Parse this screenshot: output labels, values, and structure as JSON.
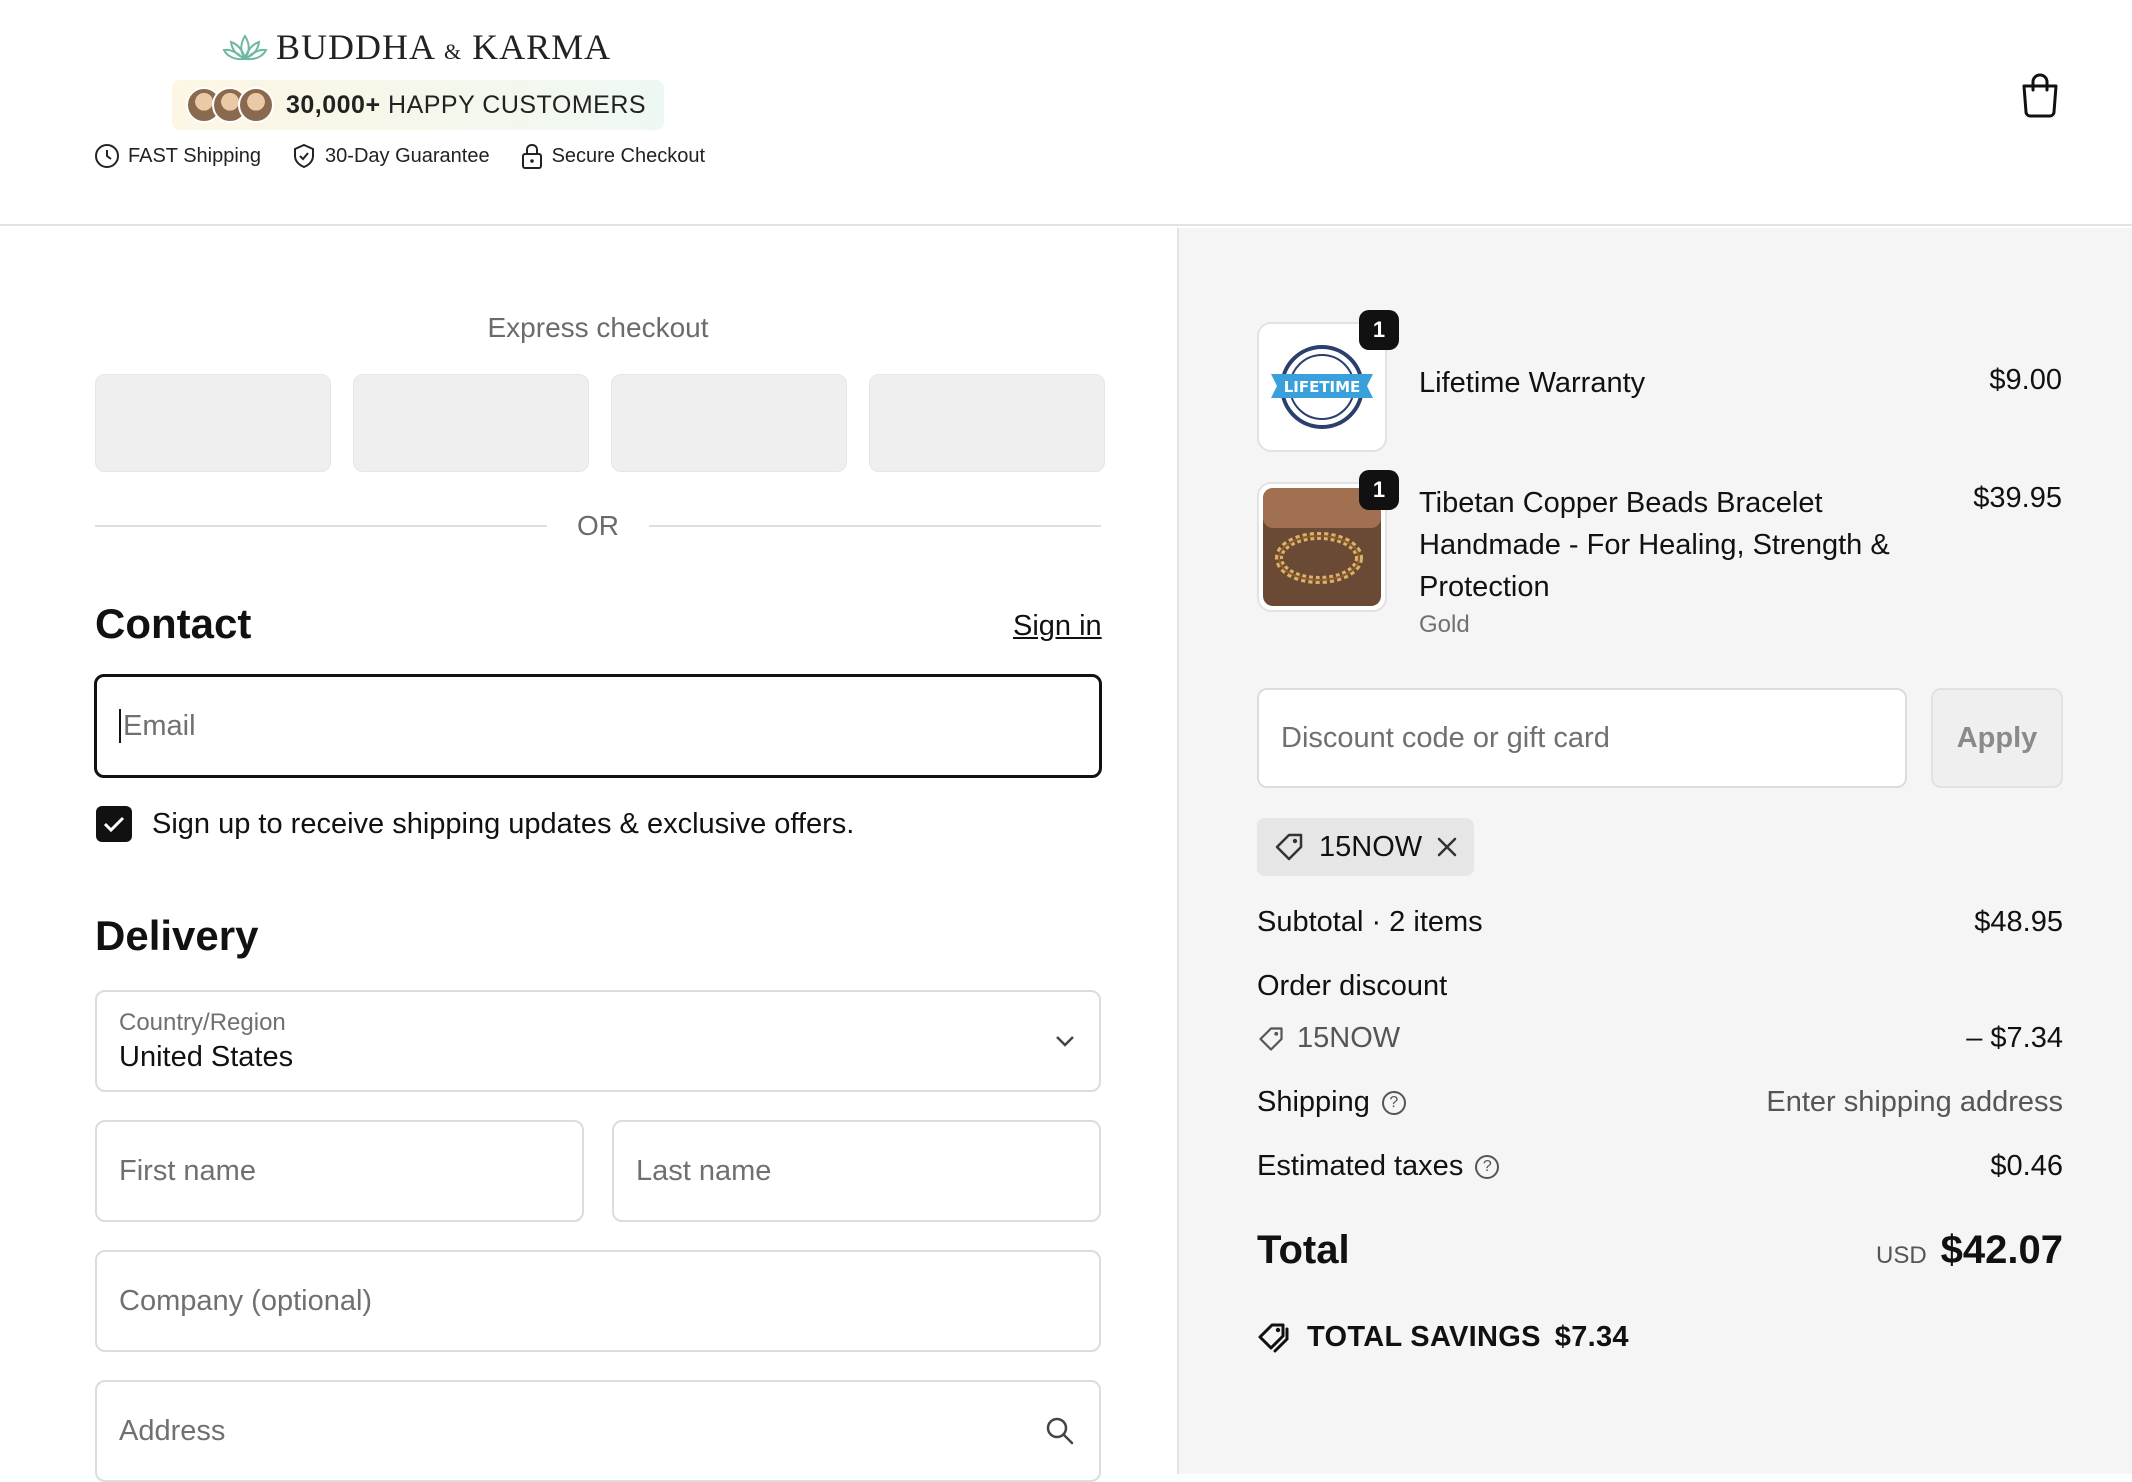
{
  "brand": {
    "name_left": "BUDDHA",
    "name_amp": "&",
    "name_right": "KARMA",
    "happy_count": "30,000+",
    "happy_text": "HAPPY CUSTOMERS"
  },
  "trust_badges": [
    {
      "icon": "clock-icon",
      "label": "FAST Shipping"
    },
    {
      "icon": "shield-check-icon",
      "label": "30-Day Guarantee"
    },
    {
      "icon": "lock-icon",
      "label": "Secure Checkout"
    }
  ],
  "express": {
    "title": "Express checkout",
    "or": "OR"
  },
  "contact": {
    "heading": "Contact",
    "sign_in": "Sign in",
    "email_placeholder": "Email",
    "optin_label": "Sign up to receive shipping updates & exclusive offers.",
    "optin_checked": true
  },
  "delivery": {
    "heading": "Delivery",
    "country_label": "Country/Region",
    "country_value": "United States",
    "first_name_placeholder": "First name",
    "last_name_placeholder": "Last name",
    "company_placeholder": "Company (optional)",
    "address_placeholder": "Address"
  },
  "cart": {
    "items": [
      {
        "name": "Lifetime Warranty",
        "variant": "",
        "qty": "1",
        "price": "$9.00",
        "thumb_text": "LIFETIME"
      },
      {
        "name": "Tibetan Copper Beads Bracelet Handmade - For Healing, Strength & Protection",
        "variant": "Gold",
        "qty": "1",
        "price": "$39.95"
      }
    ],
    "discount_placeholder": "Discount code or gift card",
    "apply_label": "Apply",
    "applied_code": "15NOW"
  },
  "summary": {
    "subtotal_label": "Subtotal · 2 items",
    "subtotal_value": "$48.95",
    "order_discount_label": "Order discount",
    "discount_code": "15NOW",
    "discount_value": "– $7.34",
    "shipping_label": "Shipping",
    "shipping_value": "Enter shipping address",
    "taxes_label": "Estimated taxes",
    "taxes_value": "$0.46",
    "total_label": "Total",
    "currency": "USD",
    "total_value": "$42.07",
    "savings_label": "TOTAL SAVINGS",
    "savings_value": "$7.34"
  }
}
